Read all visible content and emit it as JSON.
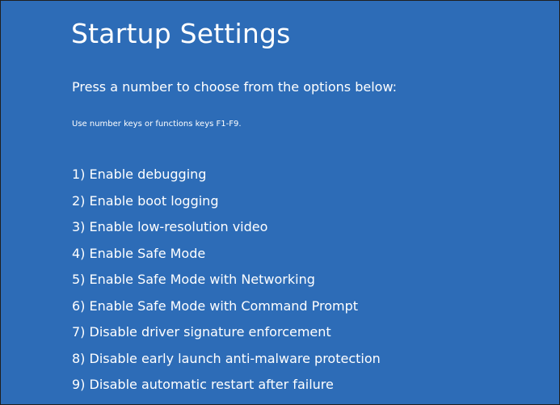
{
  "screen": {
    "title": "Startup Settings",
    "subtitle": "Press a number to choose from the options below:",
    "hint": "Use number keys or functions keys F1-F9.",
    "background_color": "#2d6cb7",
    "options": [
      "1) Enable debugging",
      "2) Enable boot logging",
      "3) Enable low-resolution video",
      "4) Enable Safe Mode",
      "5) Enable Safe Mode with Networking",
      "6) Enable Safe Mode with Command Prompt",
      "7) Disable driver signature enforcement",
      "8) Disable early launch anti-malware protection",
      "9) Disable automatic restart after failure"
    ]
  }
}
